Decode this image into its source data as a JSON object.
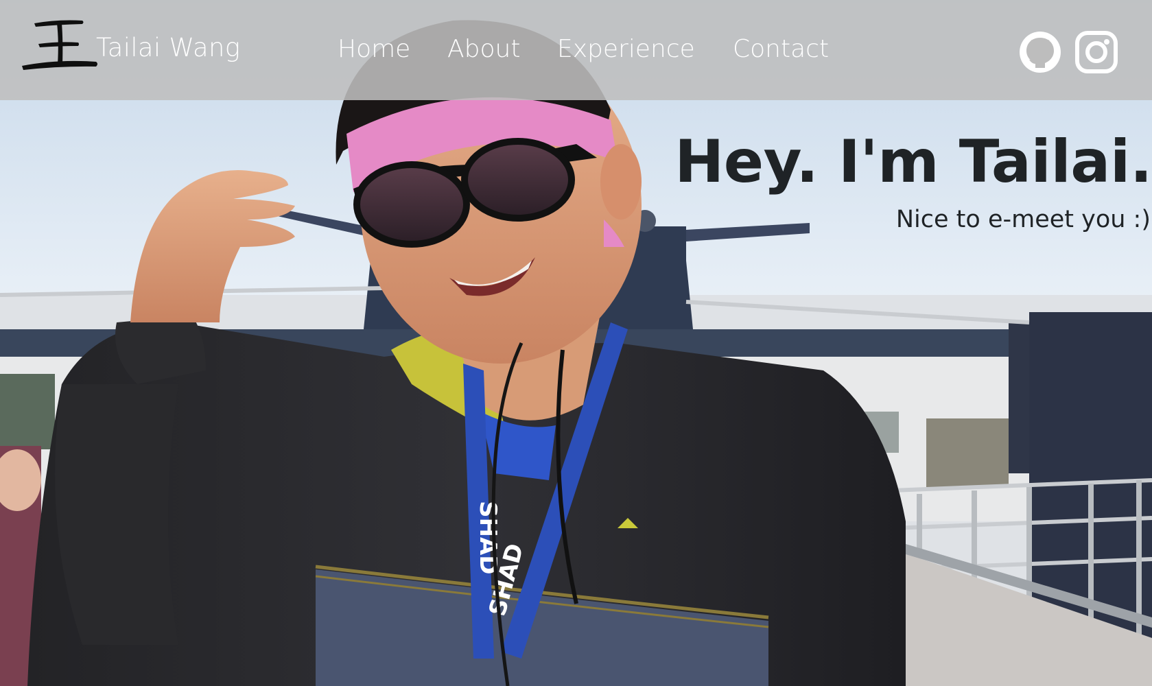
{
  "brand": {
    "logo_glyph": "王",
    "name": "Tailai Wang"
  },
  "nav": [
    {
      "label": "Home"
    },
    {
      "label": "About"
    },
    {
      "label": "Experience"
    },
    {
      "label": "Contact"
    }
  ],
  "social": [
    {
      "icon": "github-icon"
    },
    {
      "icon": "instagram-icon"
    }
  ],
  "hero": {
    "headline": "Hey. I'm Tailai.",
    "subline": "Nice to e-meet you :)",
    "lanyard_text": "SHAD"
  },
  "colors": {
    "navbar_overlay": "#bebebe",
    "nav_text": "#ffffff",
    "headline": "#1f2326",
    "bandana": "#e58ac6",
    "jacket": "#2a2a2e",
    "lanyard": "#2c4fb8"
  }
}
